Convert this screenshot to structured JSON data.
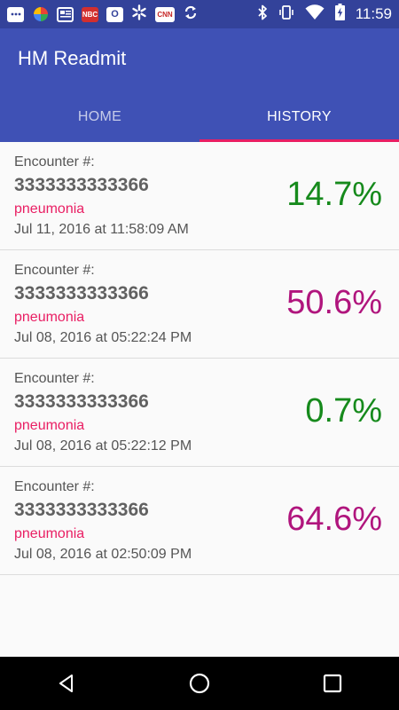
{
  "status_bar": {
    "time": "11:59",
    "icons": [
      "messages-icon",
      "photos-icon",
      "news-icon",
      "cnbc-icon",
      "outlook-icon",
      "walmart-icon",
      "cnn-icon",
      "sync-icon",
      "bluetooth-icon",
      "vibrate-icon",
      "wifi-icon",
      "battery-charging-icon"
    ],
    "cnn_label": "CNN",
    "cnbc_label": "NBC",
    "outlook_label": "O"
  },
  "app": {
    "title": "HM Readmit",
    "primary_color": "#3f51b5",
    "accent_color": "#e91e63"
  },
  "tabs": [
    {
      "label": "HOME",
      "active": false
    },
    {
      "label": "HISTORY",
      "active": true
    }
  ],
  "history": [
    {
      "encounter_label": "Encounter #:",
      "encounter_number": "3333333333366",
      "diagnosis": "pneumonia",
      "date": "Jul 11, 2016 at 11:58:09 AM",
      "percent": "14.7%",
      "percent_color": "#168a1c"
    },
    {
      "encounter_label": "Encounter #:",
      "encounter_number": "3333333333366",
      "diagnosis": "pneumonia",
      "date": "Jul 08, 2016 at 05:22:24 PM",
      "percent": "50.6%",
      "percent_color": "#b0157d"
    },
    {
      "encounter_label": "Encounter #:",
      "encounter_number": "3333333333366",
      "diagnosis": "pneumonia",
      "date": "Jul 08, 2016 at 05:22:12 PM",
      "percent": "0.7%",
      "percent_color": "#168a1c"
    },
    {
      "encounter_label": "Encounter #:",
      "encounter_number": "3333333333366",
      "diagnosis": "pneumonia",
      "date": "Jul 08, 2016 at 02:50:09 PM",
      "percent": "64.6%",
      "percent_color": "#b0157d"
    }
  ],
  "nav_bar": {
    "buttons": [
      "back-icon",
      "home-icon",
      "recents-icon"
    ]
  }
}
